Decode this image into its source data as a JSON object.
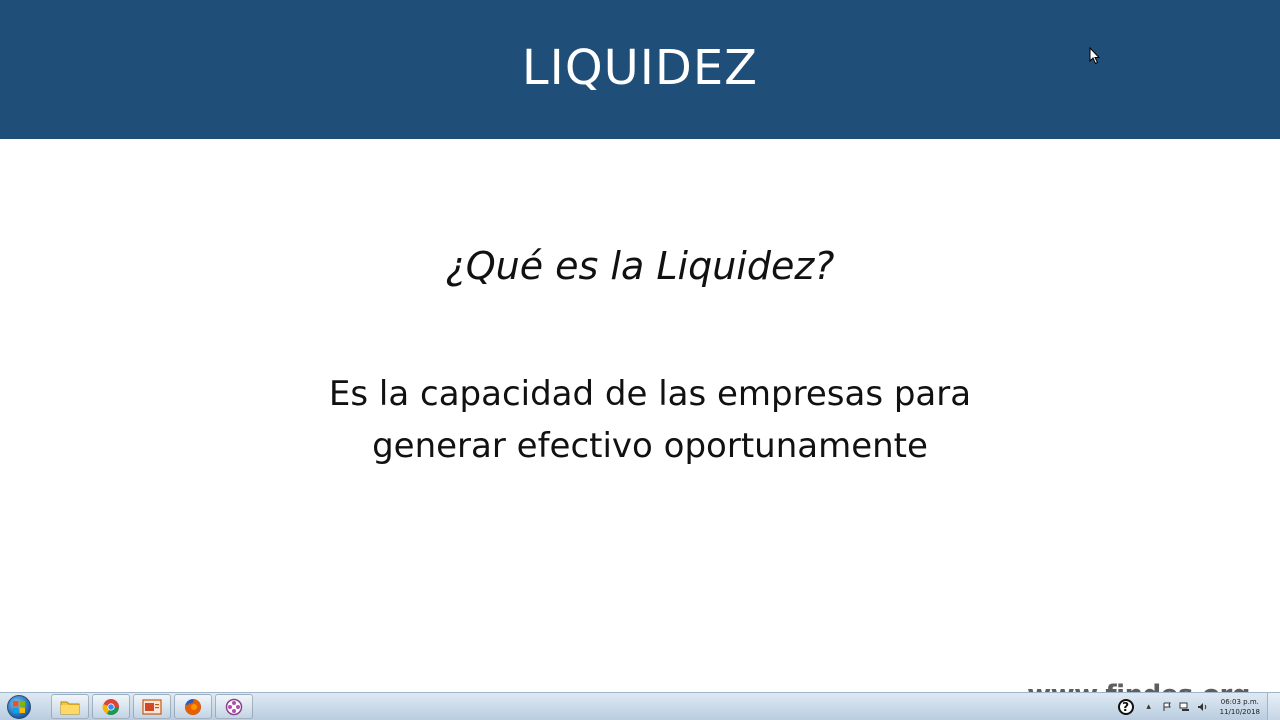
{
  "slide": {
    "title": "LIQUIDEZ",
    "question": "¿Qué es la Liquidez?",
    "answer_line1": "Es la capacidad de las empresas para",
    "answer_line2": "generar efectivo oportunamente"
  },
  "watermark": {
    "text": "www.findes.org"
  },
  "taskbar": {
    "apps": [
      {
        "icon": "folder-icon"
      },
      {
        "icon": "chrome-icon"
      },
      {
        "icon": "powerpoint-icon"
      },
      {
        "icon": "firefox-icon"
      },
      {
        "icon": "app-icon"
      }
    ],
    "help_label": "?",
    "clock": {
      "time": "06:03 p.m.",
      "date": "11/10/2018"
    }
  },
  "colors": {
    "title_bar": "#1f4e79",
    "background": "#ffffff",
    "text": "#111111"
  }
}
